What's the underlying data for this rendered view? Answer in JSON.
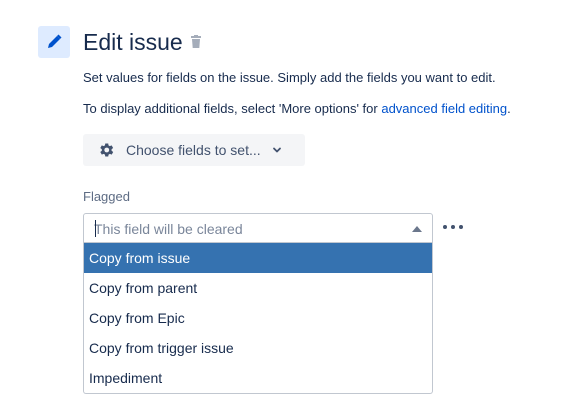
{
  "header": {
    "title": "Edit issue",
    "edit_icon": "pencil-icon",
    "delete_icon": "trash-icon"
  },
  "description": {
    "line1": "Set values for fields on the issue. Simply add the fields you want to edit.",
    "line2_prefix": "To display additional fields, select 'More options' for ",
    "line2_link": "advanced field editing",
    "line2_suffix": "."
  },
  "choose_fields": {
    "label": "Choose fields to set...",
    "icon": "gear-icon",
    "chevron": "chevron-down-icon"
  },
  "field": {
    "label": "Flagged",
    "placeholder": "This field will be cleared",
    "value": "",
    "more_icon": "more-horizontal-icon"
  },
  "dropdown": {
    "options": [
      {
        "label": "Copy from issue",
        "selected": true
      },
      {
        "label": "Copy from parent",
        "selected": false
      },
      {
        "label": "Copy from Epic",
        "selected": false
      },
      {
        "label": "Copy from trigger issue",
        "selected": false
      },
      {
        "label": "Impediment",
        "selected": false
      }
    ]
  },
  "colors": {
    "accent": "#0052cc",
    "icon_bg": "#deebff",
    "selected_bg": "#3572b0",
    "text": "#172b4d"
  }
}
